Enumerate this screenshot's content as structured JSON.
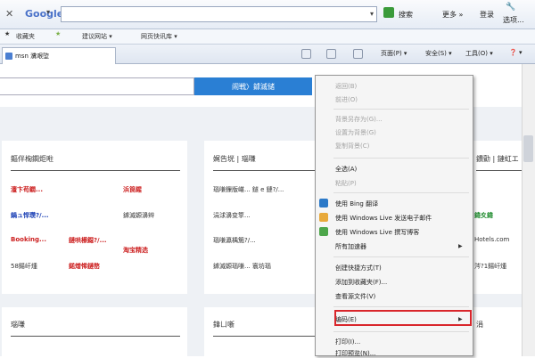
{
  "google_bar": {
    "close": "✕",
    "logo": "Google",
    "dropdown": "▾",
    "search_value": "",
    "search_btn": "搜索",
    "more_btn": "更多 »",
    "login_btn": "登录",
    "options_btn": "选项..."
  },
  "favorites_bar": {
    "favorites": "收藏夹",
    "suggested": "建议网站 ▾",
    "slices": "网页快讯库 ▾"
  },
  "tab": {
    "label": "msn 瀵艰埅"
  },
  "command_bar": {
    "page": "页面(P) ▾",
    "safety": "安全(S) ▾",
    "tools": "工具(O) ▾",
    "help": "❓ ▾"
  },
  "page": {
    "search_button": "闹戦〉鎼滅储",
    "cards": [
      {
        "title": "鏂伴椈鐧炬暀"
      },
      {
        "title": "娓告垙 | 瑙嗛"
      },
      {
        "title": "鐨勯 | 鏈虹エ"
      }
    ],
    "col1": [
      {
        "text": "澶卞苟鐗...",
        "color": "red"
      },
      {
        "text": "鍋ュ悍瓒?/...",
        "color": "blue"
      },
      {
        "text": "Booking...",
        "color": "red"
      },
      {
        "text": "58鍚屽煄",
        "color": "gray"
      }
    ],
    "col2": [
      {
        "text": "浜笢鍟",
        "color": "red"
      },
      {
        "text": "鎼滅嫄濞辫",
        "color": "gray"
      },
      {
        "text": "鏈哄櫒鐚?/...",
        "color": "red"
      },
      {
        "text": "鍩熷悕鏈嶅",
        "color": "red"
      }
    ],
    "col2b": [
      {
        "text": "",
        "color": "red"
      },
      {
        "text": "",
        "color": "gray"
      },
      {
        "text": "淘宝精选",
        "color": "red"
      },
      {
        "text": "",
        "color": "red"
      }
    ],
    "col3": [
      {
        "text": "瑙嗛鏁版嵁... 鐩 e 鏈?/...",
        "color": "gray"
      },
      {
        "text": "涓浗濞变箰...",
        "color": "gray"
      },
      {
        "text": "瑙嗛瀛楀箷?/...",
        "color": "gray"
      },
      {
        "text": "鎼滅嫄瑙嗛... 寰坊瑙",
        "color": "gray"
      }
    ],
    "col4": [
      {
        "text": "鍏夊鍏",
        "color": "green"
      },
      {
        "text": "Hotels.com",
        "color": "gray"
      },
      {
        "text": "涔?1鍚屽煄",
        "color": "gray"
      }
    ],
    "row2": [
      {
        "title": "瑙嗛"
      },
      {
        "title": "鍏ㄩ噺"
      },
      {
        "title": "涓"
      }
    ]
  },
  "context_menu": {
    "items": [
      {
        "label": "返回(B)",
        "enabled": false
      },
      {
        "label": "前进(O)",
        "enabled": false
      },
      {
        "label": "背景另存为(G)...",
        "enabled": false
      },
      {
        "label": "设置为背景(G)",
        "enabled": false
      },
      {
        "label": "复制背景(C)",
        "enabled": false
      },
      {
        "label": "全选(A)",
        "enabled": true
      },
      {
        "label": "粘贴(P)",
        "enabled": false
      },
      {
        "label": "使用 Bing 翻译",
        "enabled": true
      },
      {
        "label": "使用 Windows Live 发送电子邮件",
        "enabled": true
      },
      {
        "label": "使用 Windows Live 撰写博客",
        "enabled": true
      },
      {
        "label": "所有加速器",
        "enabled": true
      },
      {
        "label": "创建快捷方式(T)",
        "enabled": true
      },
      {
        "label": "添加到收藏夹(F)...",
        "enabled": true
      },
      {
        "label": "查看源文件(V)",
        "enabled": true
      },
      {
        "label": "编码(E)",
        "enabled": true
      },
      {
        "label": "打印(I)...",
        "enabled": true
      },
      {
        "label": "打印预览(N)...",
        "enabled": true
      }
    ],
    "highlighted_item": "编码(E)"
  },
  "colors": {
    "search_button": "#2a7fd4",
    "highlight_border": "#d9262b",
    "link_red": "#cc1f1f",
    "link_blue": "#1a3fb5"
  }
}
